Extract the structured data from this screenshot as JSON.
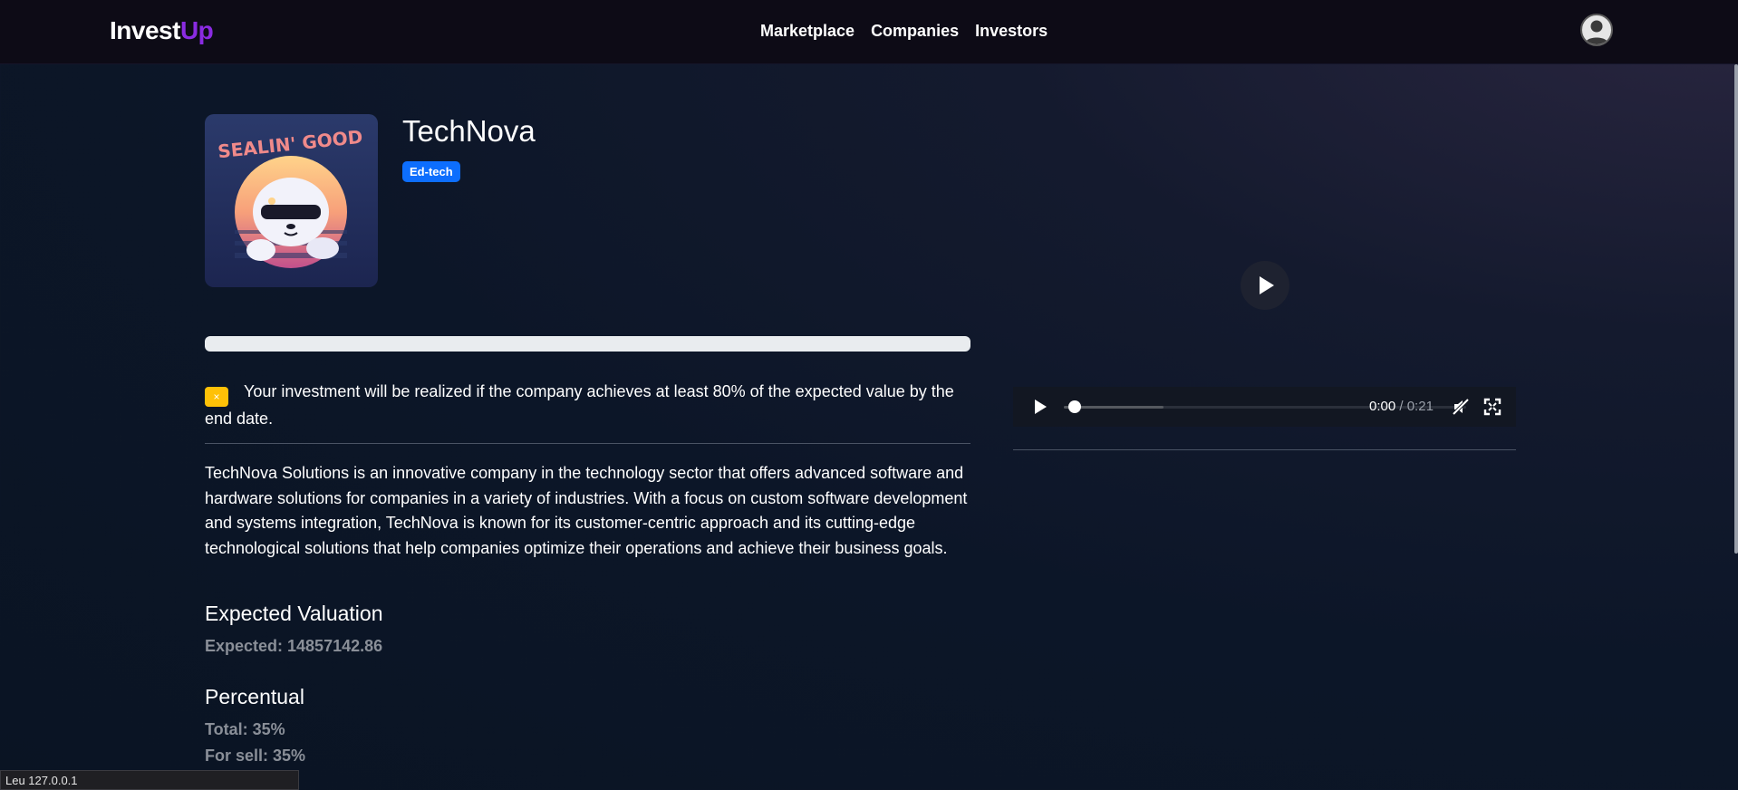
{
  "brand": {
    "part1": "Invest",
    "part2": "Up",
    "accent": "#8a2be2"
  },
  "nav": {
    "items": [
      "Marketplace",
      "Companies",
      "Investors"
    ]
  },
  "user": {
    "avatar_icon": "user-avatar-icon"
  },
  "company": {
    "name": "TechNova",
    "tag": "Ed-tech",
    "logo_text": "SEALIN' GOOD",
    "investment_progress_percent": 0,
    "notice_icon": "×",
    "notice": "Your investment will be realized if the company achieves at least 80% of the expected value by the end date.",
    "description": "TechNova Solutions is an innovative company in the technology sector that offers advanced software and hardware solutions for companies in a variety of industries. With a focus on custom software development and systems integration, TechNova is known for its customer-centric approach and its cutting-edge technological solutions that help companies optimize their operations and achieve their business goals.",
    "valuation_heading": "Expected Valuation",
    "expected": "Expected: 14857142.86",
    "percentual_heading": "Percentual",
    "total": "Total: 35%",
    "for_sell": "For sell: 35%"
  },
  "video": {
    "current_time": "0:00",
    "separator": " / ",
    "duration": "0:21",
    "progress_fraction": 0
  },
  "status_bar": {
    "text": "Leu 127.0.0.1"
  },
  "colors": {
    "tag_bg": "#0d6efd",
    "warning": "#ffc107",
    "navbar": "#0d0b16"
  }
}
